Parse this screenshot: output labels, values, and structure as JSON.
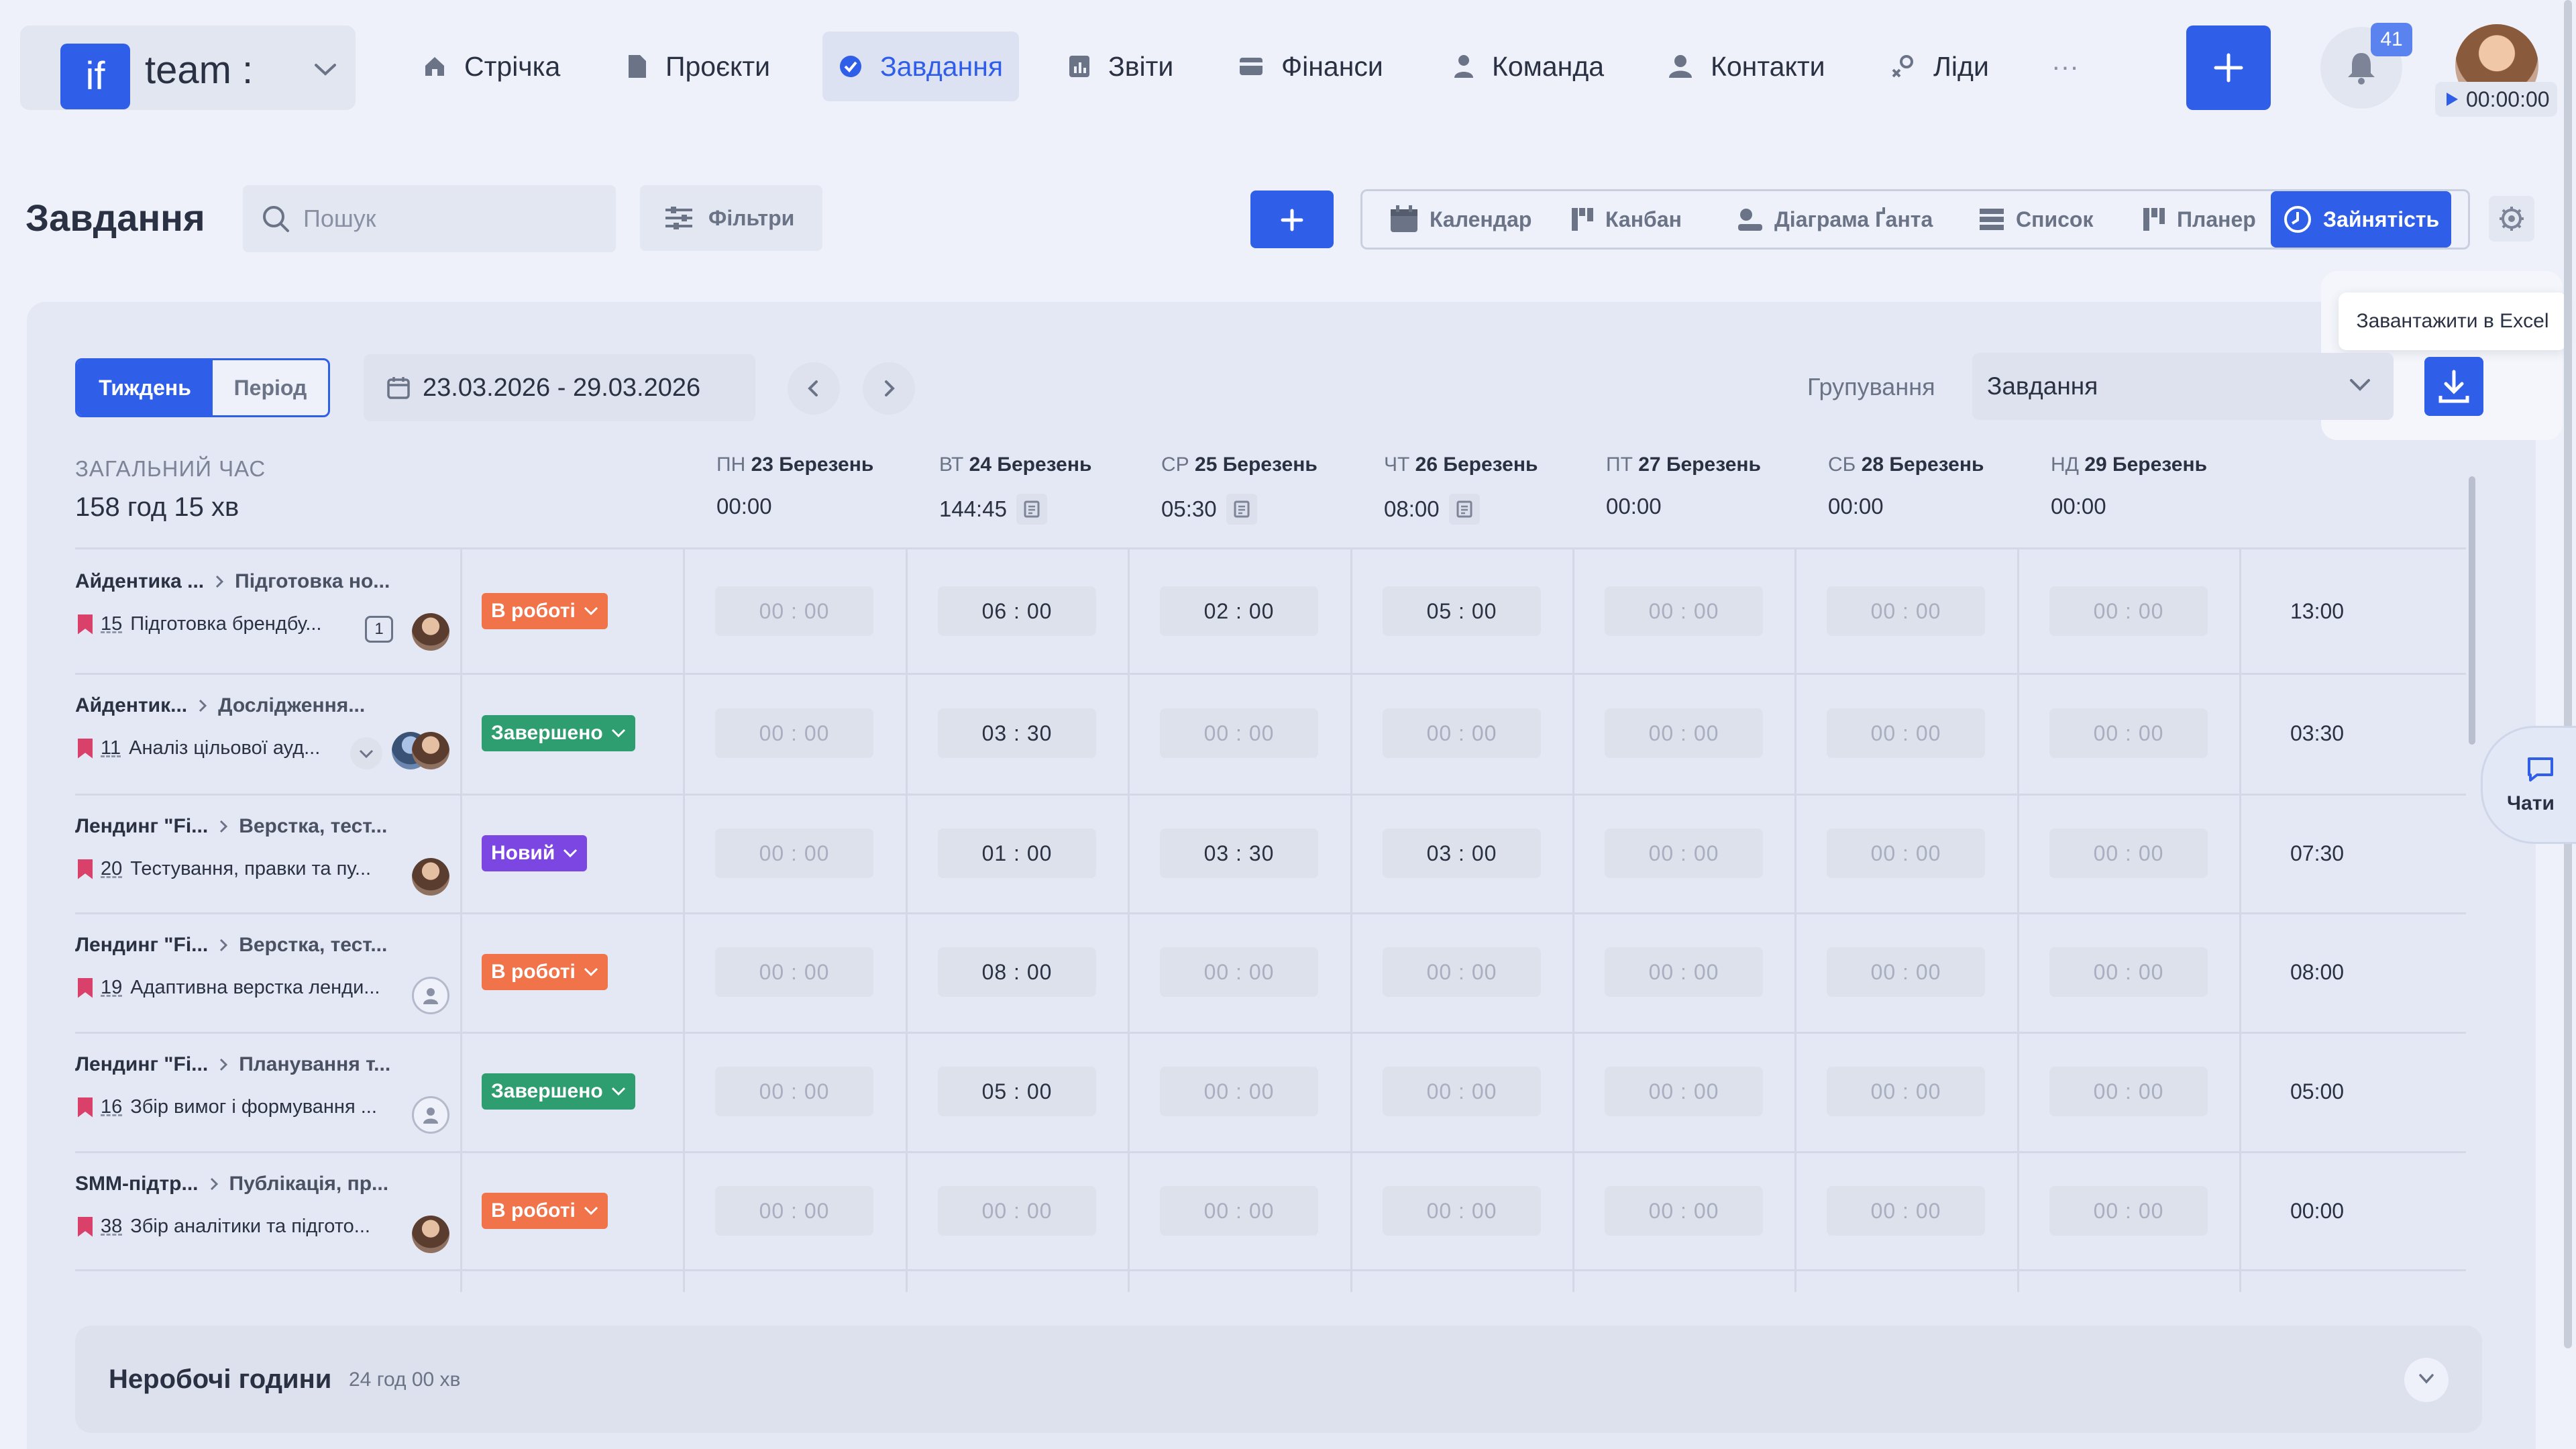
{
  "brand": {
    "logo_text": "if",
    "name": "team :"
  },
  "nav": [
    {
      "label": "Стрічка",
      "icon": "home-icon"
    },
    {
      "label": "Проєкти",
      "icon": "file-icon"
    },
    {
      "label": "Завдання",
      "icon": "check-circle-icon",
      "active": true
    },
    {
      "label": "Звіти",
      "icon": "report-icon"
    },
    {
      "label": "Фінанси",
      "icon": "wallet-icon"
    },
    {
      "label": "Команда",
      "icon": "user-icon"
    },
    {
      "label": "Контакти",
      "icon": "contacts-icon"
    },
    {
      "label": "Ліди",
      "icon": "leads-icon"
    },
    {
      "label": "···",
      "icon": "more-icon"
    }
  ],
  "notifications": {
    "count": "41"
  },
  "timer": {
    "value": "00:00:00"
  },
  "page": {
    "title": "Завдання",
    "search_placeholder": "Пошук",
    "filters_label": "Фільтри"
  },
  "views": [
    {
      "label": "Календар",
      "icon": "calendar-icon"
    },
    {
      "label": "Канбан",
      "icon": "kanban-icon"
    },
    {
      "label": "Діаграма Ґанта",
      "icon": "gantt-icon"
    },
    {
      "label": "Список",
      "icon": "list-icon"
    },
    {
      "label": "Планер",
      "icon": "planner-icon"
    },
    {
      "label": "Зайнятість",
      "icon": "clock-icon",
      "active": true
    }
  ],
  "period": {
    "week_label": "Тиждень",
    "period_label": "Період",
    "range": "23.03.2026 - 29.03.2026"
  },
  "grouping": {
    "label": "Групування",
    "value": "Завдання"
  },
  "excel_tooltip": "Завантажити в Excel",
  "summary": {
    "label": "ЗАГАЛЬНИЙ ЧАС",
    "value": "158 год 15 хв"
  },
  "days": [
    {
      "dow": "ПН",
      "date": "23 Березень",
      "total": "00:00",
      "note": false
    },
    {
      "dow": "ВТ",
      "date": "24 Березень",
      "total": "144:45",
      "note": true
    },
    {
      "dow": "СР",
      "date": "25 Березень",
      "total": "05:30",
      "note": true
    },
    {
      "dow": "ЧТ",
      "date": "26 Березень",
      "total": "08:00",
      "note": true
    },
    {
      "dow": "ПТ",
      "date": "27 Березень",
      "total": "00:00",
      "note": false
    },
    {
      "dow": "СБ",
      "date": "28 Березень",
      "total": "00:00",
      "note": false
    },
    {
      "dow": "НД",
      "date": "29 Березень",
      "total": "00:00",
      "note": false
    }
  ],
  "rows": [
    {
      "project": "Айдентика ...",
      "stage": "Підготовка но...",
      "num": "15",
      "task": "Підготовка брендбу...",
      "badge": "1",
      "avatar": "photo",
      "status": "В роботі",
      "status_kind": "work",
      "cells": [
        "00 : 00",
        "06 : 00",
        "02 : 00",
        "05 : 00",
        "00 : 00",
        "00 : 00",
        "00 : 00"
      ],
      "total": "13:00"
    },
    {
      "project": "Айдентик...",
      "stage": "Дослідження...",
      "num": "11",
      "task": "Аналіз цільової ауд...",
      "badge": "",
      "avatar": "group",
      "status": "Завершено",
      "status_kind": "done",
      "cells": [
        "00 : 00",
        "03 : 30",
        "00 : 00",
        "00 : 00",
        "00 : 00",
        "00 : 00",
        "00 : 00"
      ],
      "total": "03:30"
    },
    {
      "project": "Лендинг \"Fi...",
      "stage": "Верстка, тест...",
      "num": "20",
      "task": "Тестування, правки та пу...",
      "badge": "",
      "avatar": "photo",
      "status": "Новий",
      "status_kind": "new",
      "cells": [
        "00 : 00",
        "01 : 00",
        "03 : 30",
        "03 : 00",
        "00 : 00",
        "00 : 00",
        "00 : 00"
      ],
      "total": "07:30"
    },
    {
      "project": "Лендинг \"Fi...",
      "stage": "Верстка, тест...",
      "num": "19",
      "task": "Адаптивна верстка ленди...",
      "badge": "",
      "avatar": "empty",
      "status": "В роботі",
      "status_kind": "work",
      "cells": [
        "00 : 00",
        "08 : 00",
        "00 : 00",
        "00 : 00",
        "00 : 00",
        "00 : 00",
        "00 : 00"
      ],
      "total": "08:00"
    },
    {
      "project": "Лендинг \"Fi...",
      "stage": "Планування т...",
      "num": "16",
      "task": "Збір вимог і формування ...",
      "badge": "",
      "avatar": "empty",
      "status": "Завершено",
      "status_kind": "done",
      "cells": [
        "00 : 00",
        "05 : 00",
        "00 : 00",
        "00 : 00",
        "00 : 00",
        "00 : 00",
        "00 : 00"
      ],
      "total": "05:00"
    },
    {
      "project": "SMM-підтр...",
      "stage": "Публікація, пр...",
      "num": "38",
      "task": "Збір аналітики та підгото...",
      "badge": "",
      "avatar": "photo",
      "status": "В роботі",
      "status_kind": "work",
      "cells": [
        "00 : 00",
        "00 : 00",
        "00 : 00",
        "00 : 00",
        "00 : 00",
        "00 : 00",
        "00 : 00"
      ],
      "total": "00:00"
    }
  ],
  "chats_label": "Чати",
  "offhours": {
    "title": "Неробочі години",
    "value": "24 год 00 хв"
  },
  "colors": {
    "accent": "#2f5ee8",
    "work": "#f0734a",
    "done": "#2e9d6f",
    "new": "#7c46e3",
    "flag": "#d9416b"
  }
}
